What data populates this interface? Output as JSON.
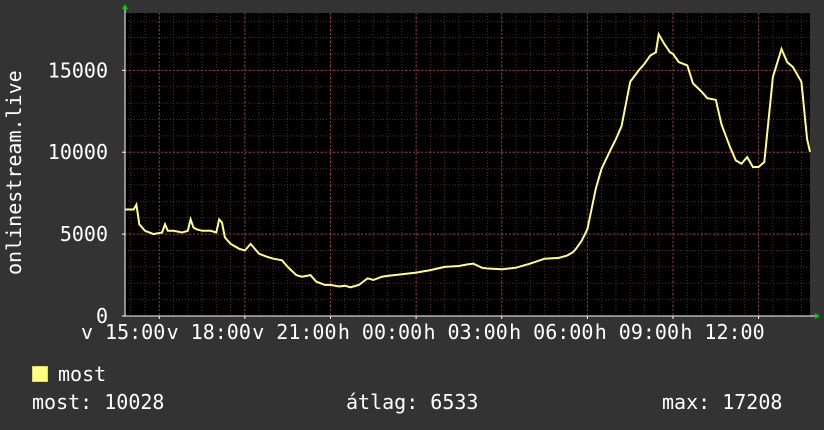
{
  "chart_data": {
    "type": "line",
    "ylabel": "onlinestream.live",
    "ylim": [
      0,
      18500
    ],
    "yticks": [
      0,
      5000,
      10000,
      15000
    ],
    "ytick_labels": [
      "0",
      "5000",
      "10000",
      "15000"
    ],
    "xtick_labels": [
      "v 15:00",
      "v 18:00",
      "v 21:00",
      "h 00:00",
      "h 03:00",
      "h 06:00",
      "h 09:00",
      "h 12:00"
    ],
    "x_range_hours": [
      13.8,
      37.8
    ],
    "xticks_hours": [
      15,
      18,
      21,
      24,
      27,
      30,
      33,
      36
    ],
    "grid": true,
    "series": [
      {
        "name": "most",
        "color": "#ffff80",
        "x": [
          13.8,
          14.1,
          14.2,
          14.3,
          14.5,
          14.8,
          15.1,
          15.2,
          15.3,
          15.5,
          15.8,
          16.0,
          16.1,
          16.2,
          16.3,
          16.5,
          16.8,
          17.0,
          17.1,
          17.2,
          17.3,
          17.5,
          17.8,
          18.0,
          18.2,
          18.5,
          18.8,
          19.0,
          19.3,
          19.5,
          19.8,
          20.0,
          20.3,
          20.5,
          20.8,
          21.0,
          21.3,
          21.5,
          21.7,
          21.8,
          22.0,
          22.3,
          22.5,
          22.8,
          23.0,
          23.5,
          24.0,
          24.5,
          25.0,
          25.5,
          25.8,
          26.0,
          26.3,
          26.5,
          27.0,
          27.5,
          28.0,
          28.5,
          29.0,
          29.3,
          29.5,
          29.6,
          29.8,
          30.0,
          30.3,
          30.5,
          30.8,
          31.0,
          31.2,
          31.5,
          31.8,
          32.0,
          32.2,
          32.4,
          32.5,
          32.7,
          32.9,
          33.0,
          33.2,
          33.5,
          33.7,
          34.0,
          34.2,
          34.5,
          34.7,
          35.0,
          35.2,
          35.4,
          35.6,
          35.8,
          36.0,
          36.2,
          36.5,
          36.8,
          37.0,
          37.2,
          37.5,
          37.7,
          37.8
        ],
        "values": [
          6500,
          6500,
          6800,
          5600,
          5200,
          5000,
          5100,
          5600,
          5200,
          5200,
          5100,
          5200,
          5900,
          5400,
          5300,
          5200,
          5200,
          5100,
          5900,
          5700,
          4800,
          4400,
          4100,
          4000,
          4400,
          3800,
          3600,
          3500,
          3400,
          3000,
          2500,
          2400,
          2500,
          2100,
          1900,
          1900,
          1800,
          1850,
          1750,
          1800,
          1900,
          2300,
          2200,
          2400,
          2450,
          2550,
          2650,
          2800,
          3000,
          3050,
          3150,
          3200,
          2950,
          2900,
          2850,
          2950,
          3200,
          3500,
          3550,
          3700,
          3900,
          4100,
          4600,
          5300,
          7800,
          9000,
          10100,
          10800,
          11600,
          14300,
          15000,
          15400,
          15900,
          16100,
          17200,
          16600,
          16100,
          16000,
          15500,
          15300,
          14200,
          13700,
          13300,
          13200,
          11700,
          10300,
          9500,
          9300,
          9700,
          9100,
          9100,
          9400,
          14600,
          16300,
          15500,
          15200,
          14300,
          10800,
          10028
        ]
      }
    ]
  },
  "legend": {
    "label": "most"
  },
  "stats": {
    "current": "most: 10028",
    "average": "átlag: 6533",
    "max": "max: 17208"
  },
  "colors": {
    "background": "#333333",
    "plot_background": "#000000",
    "grid": "#5a2a2a",
    "axis": "#ffffff",
    "axis_arrow": "#00cc00",
    "series": "#ffff80"
  }
}
